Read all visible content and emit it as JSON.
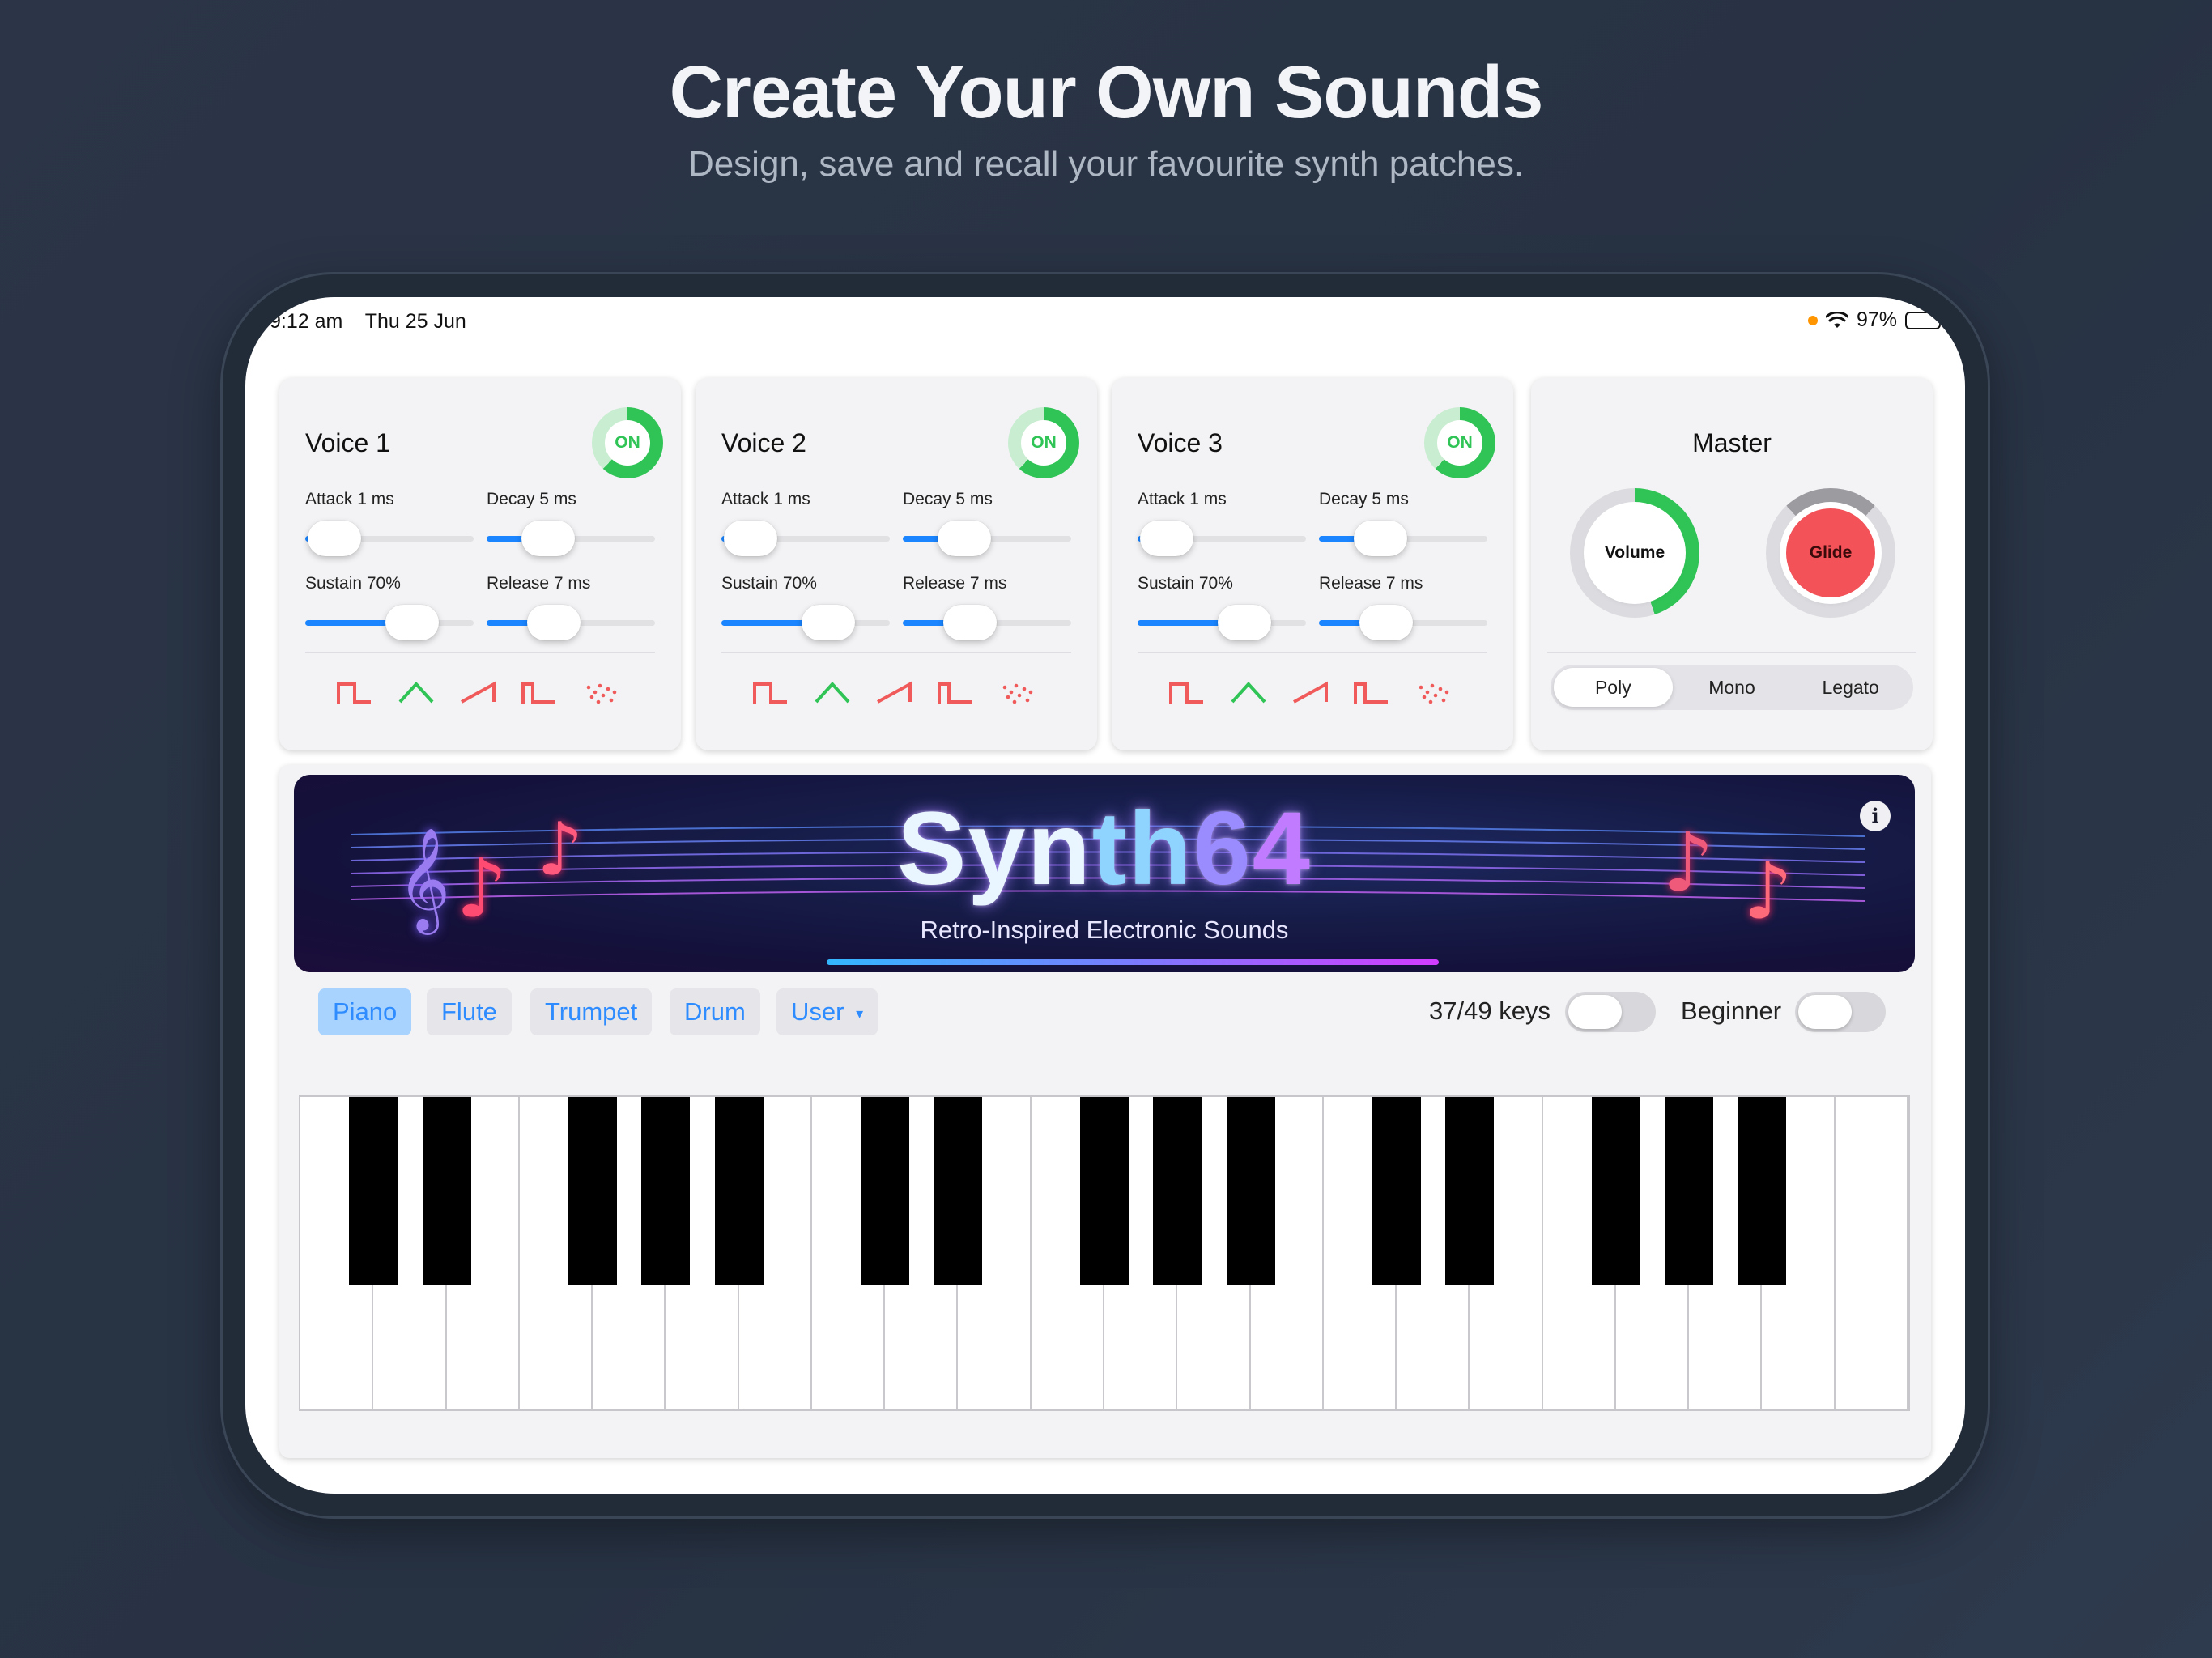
{
  "marketing": {
    "headline": "Create Your Own Sounds",
    "subline": "Design, save and recall your favourite synth patches."
  },
  "status_bar": {
    "time": "9:12 am",
    "date": "Thu 25 Jun",
    "battery": "97%"
  },
  "voices": [
    {
      "title": "Voice 1",
      "toggle": "ON",
      "attack": "Attack 1 ms",
      "decay": "Decay 5 ms",
      "sustain": "Sustain 70%",
      "release": "Release 7 ms"
    },
    {
      "title": "Voice 2",
      "toggle": "ON",
      "attack": "Attack 1 ms",
      "decay": "Decay 5 ms",
      "sustain": "Sustain 70%",
      "release": "Release 7 ms"
    },
    {
      "title": "Voice 3",
      "toggle": "ON",
      "attack": "Attack 1 ms",
      "decay": "Decay 5 ms",
      "sustain": "Sustain 70%",
      "release": "Release 7 ms"
    }
  ],
  "slider_levels": {
    "attack": 0.02,
    "decay": 0.3,
    "sustain": 0.7,
    "release": 0.35
  },
  "waveforms": [
    "square-wave-icon",
    "triangle-wave-icon",
    "sawtooth-wave-icon",
    "pulse-wave-icon",
    "noise-wave-icon"
  ],
  "master": {
    "title": "Master",
    "volume_label": "Volume",
    "volume_level": 0.45,
    "glide_label": "Glide",
    "modes": [
      "Poly",
      "Mono",
      "Legato"
    ],
    "selected_mode": "Poly"
  },
  "banner": {
    "title_parts": [
      "Syn",
      "th",
      "6",
      "4"
    ],
    "subtitle": "Retro-Inspired Electronic Sounds",
    "info": "i"
  },
  "instruments": {
    "items": [
      "Piano",
      "Flute",
      "Trumpet",
      "Drum",
      "User"
    ],
    "selected": "Piano",
    "user_caret": "▾"
  },
  "controls": {
    "keys_label": "37/49 keys",
    "beginner_label": "Beginner"
  },
  "colors": {
    "accent_blue": "#1a85ff",
    "on_green": "#30c456",
    "glide_red": "#f25258",
    "wave_red": "#f05a5a",
    "wave_green": "#30c456"
  }
}
